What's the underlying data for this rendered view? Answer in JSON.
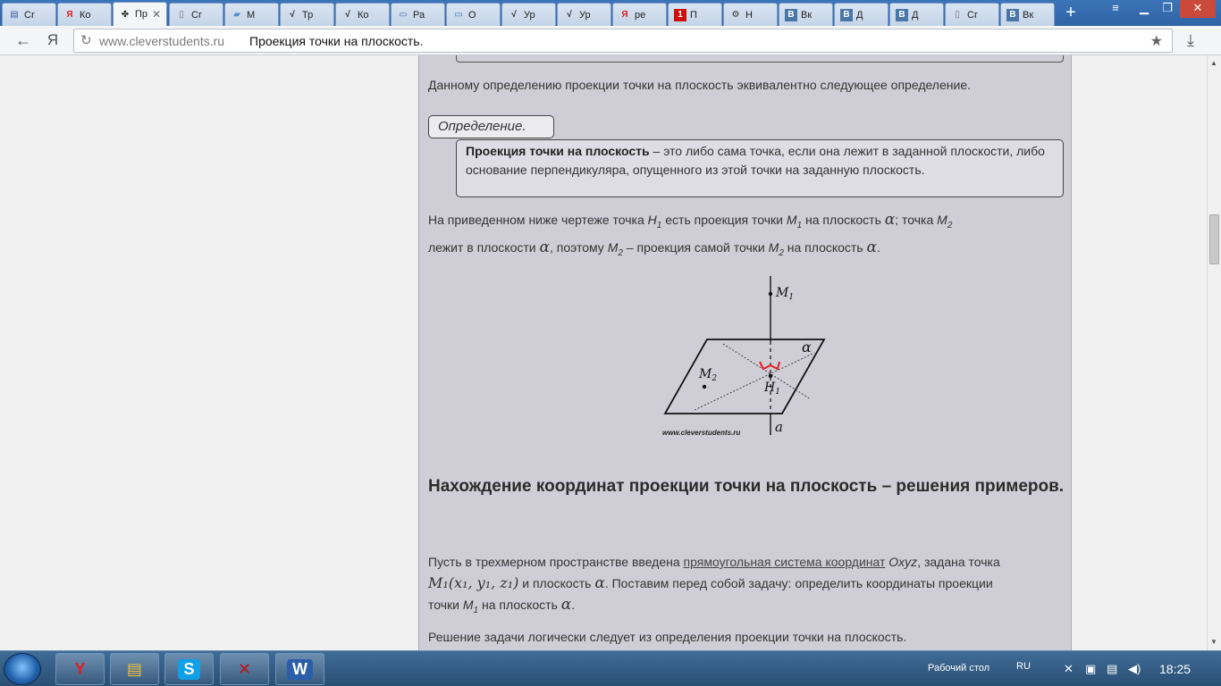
{
  "tabs": [
    {
      "label": "Cr",
      "icon": "document-icon",
      "glyph": "▤",
      "color": "#3b5fa8"
    },
    {
      "label": "Ко",
      "icon": "yandex-icon",
      "glyph": "Я",
      "color": "#e02020"
    },
    {
      "label": "Пр",
      "icon": "clover-icon",
      "glyph": "✤",
      "color": "#222"
    },
    {
      "label": "Сг",
      "icon": "page-icon",
      "glyph": "▯",
      "color": "#777"
    },
    {
      "label": "М",
      "icon": "folder-icon",
      "glyph": "▰",
      "color": "#4a90d0"
    },
    {
      "label": "Тр",
      "icon": "sqrt-icon",
      "glyph": "√",
      "color": "#222"
    },
    {
      "label": "Ко",
      "icon": "sqrt-icon",
      "glyph": "√",
      "color": "#222"
    },
    {
      "label": "Ра",
      "icon": "book-icon",
      "glyph": "▭",
      "color": "#3a70b0"
    },
    {
      "label": "О",
      "icon": "book-icon",
      "glyph": "▭",
      "color": "#3a70b0"
    },
    {
      "label": "Ур",
      "icon": "sqrt-icon",
      "glyph": "√",
      "color": "#222"
    },
    {
      "label": "Ур",
      "icon": "sqrt-icon",
      "glyph": "√",
      "color": "#222"
    },
    {
      "label": "ре",
      "icon": "yandex-icon",
      "glyph": "Я",
      "color": "#e02020"
    },
    {
      "label": "П",
      "icon": "one-icon",
      "glyph": "1",
      "color": "#fff",
      "bg": "#cc1010"
    },
    {
      "label": "Н",
      "icon": "gear-icon",
      "glyph": "⚙",
      "color": "#333"
    },
    {
      "label": "Вк",
      "icon": "vk-icon",
      "glyph": "В",
      "color": "#fff",
      "bg": "#4a76a8"
    },
    {
      "label": "Д",
      "icon": "vk-icon",
      "glyph": "В",
      "color": "#fff",
      "bg": "#4a76a8"
    },
    {
      "label": "Д",
      "icon": "vk-icon",
      "glyph": "В",
      "color": "#fff",
      "bg": "#4a76a8"
    },
    {
      "label": "Сг",
      "icon": "page-icon",
      "glyph": "▯",
      "color": "#777"
    },
    {
      "label": "Вк",
      "icon": "vk-icon",
      "glyph": "В",
      "color": "#fff",
      "bg": "#4a76a8"
    }
  ],
  "active_tab": 2,
  "address": {
    "domain": "www.cleverstudents.ru",
    "title": "Проекция точки на плоскость."
  },
  "article": {
    "equiv_text": "Данному определению проекции точки на плоскость эквивалентно следующее определение.",
    "def_label": "Определение.",
    "def_bold": "Проекция точки на плоскость",
    "def_rest": " – это либо сама точка, если она лежит в заданной плоскости, либо основание перпендикуляра, опущенного из этой точки на заданную плоскость.",
    "p1_a": "На приведенном ниже чертеже точка ",
    "p1_b": " есть проекция точки ",
    "p1_c": " на плоскость ",
    "p1_d": "; точка ",
    "p1_e": "лежит в плоскости ",
    "p1_f": ", поэтому ",
    "p1_g": " – проекция самой точки ",
    "p1_h": " на плоскость ",
    "p1_end": ".",
    "heading": "Нахождение координат проекции точки на плоскость – решения примеров.",
    "p2_a": "Пусть в трехмерном пространстве введена ",
    "p2_link": "прямоугольная система координат",
    "p2_b": " ",
    "p2_oxyz": "Oxyz",
    "p2_c": ", задана точка",
    "p2_formula": "M₁(x₁, y₁, z₁)",
    "p2_d": " и плоскость ",
    "p2_e": ". Поставим перед собой задачу: определить координаты проекции",
    "p2_f": "точки ",
    "p2_g": " на плоскость ",
    "p2_end": ".",
    "p3": "Решение задачи логически следует из определения проекции точки на плоскость."
  },
  "math": {
    "H": "H",
    "M": "M",
    "one": "1",
    "two": "2",
    "alpha": "α"
  },
  "figure": {
    "label_m1": "M",
    "label_m1_sub": "1",
    "label_m2": "M",
    "label_m2_sub": "2",
    "label_h1": "H",
    "label_h1_sub": "1",
    "label_alpha": "α",
    "label_a": "a",
    "watermark": "www.cleverstudents.ru"
  },
  "taskbar": {
    "apps": [
      {
        "name": "yandex-browser-icon",
        "glyph": "Y",
        "color": "#e02020"
      },
      {
        "name": "explorer-icon",
        "glyph": "▤",
        "color": "#f0c040"
      },
      {
        "name": "skype-icon",
        "glyph": "S",
        "color": "#fff",
        "bg": "#10a0e8"
      },
      {
        "name": "pdf-icon",
        "glyph": "✕",
        "color": "#c01010"
      },
      {
        "name": "word-icon",
        "glyph": "W",
        "color": "#fff",
        "bg": "#2a5ea8"
      }
    ],
    "desktop_label": "Рабочий стол",
    "lang": "RU",
    "clock": "18:25"
  }
}
